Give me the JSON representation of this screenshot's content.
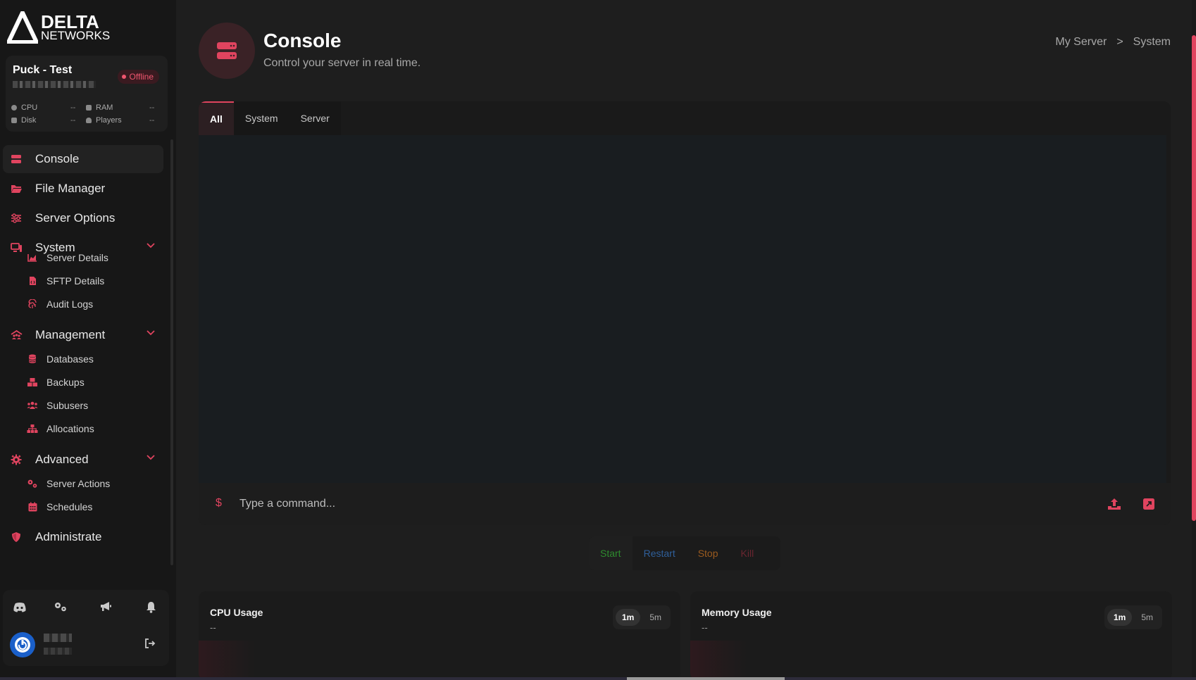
{
  "brand": {
    "top": "DELTA",
    "bottom": "NETWORKS",
    "accent": "#e0445f"
  },
  "server": {
    "name": "Puck - Test",
    "status": "Offline",
    "stats": [
      {
        "label": "CPU",
        "value": "--"
      },
      {
        "label": "RAM",
        "value": "--"
      },
      {
        "label": "Disk",
        "value": "--"
      },
      {
        "label": "Players",
        "value": "--"
      }
    ]
  },
  "nav": {
    "console": "Console",
    "file_manager": "File Manager",
    "server_options": "Server Options",
    "system": "System",
    "server_details": "Server Details",
    "sftp_details": "SFTP Details",
    "audit_logs": "Audit Logs",
    "management": "Management",
    "databases": "Databases",
    "backups": "Backups",
    "subusers": "Subusers",
    "allocations": "Allocations",
    "advanced": "Advanced",
    "server_actions": "Server Actions",
    "schedules": "Schedules",
    "administrate": "Administrate"
  },
  "header": {
    "title": "Console",
    "subtitle": "Control your server in real time.",
    "breadcrumb": [
      "My Server",
      ">",
      "System"
    ]
  },
  "console": {
    "tabs": [
      "All",
      "System",
      "Server"
    ],
    "prompt": "$",
    "placeholder": "Type a command..."
  },
  "power": {
    "start": "Start",
    "restart": "Restart",
    "stop": "Stop",
    "kill": "Kill"
  },
  "cpu_card": {
    "title": "CPU Usage",
    "value": "--",
    "ranges": [
      "1m",
      "5m"
    ]
  },
  "memory_card": {
    "title": "Memory Usage",
    "value": "--",
    "ranges": [
      "1m",
      "5m"
    ]
  }
}
